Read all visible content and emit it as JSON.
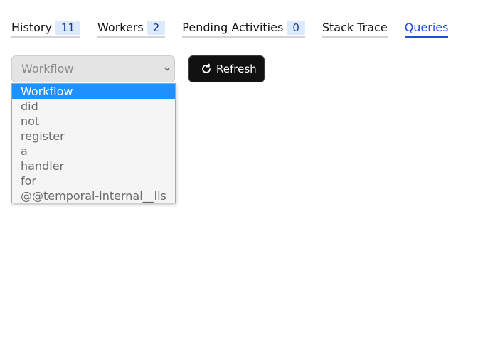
{
  "tabs": [
    {
      "label": "History",
      "badge": "11"
    },
    {
      "label": "Workers",
      "badge": "2"
    },
    {
      "label": "Pending Activities",
      "badge": "0"
    },
    {
      "label": "Stack Trace"
    },
    {
      "label": "Queries",
      "active": true
    }
  ],
  "query_select": {
    "value": "Workflow",
    "icon": "chevron-down-icon",
    "options": [
      "Workflow",
      "did",
      "not",
      "register",
      "a",
      "handler",
      "for",
      "@@temporal-internal__lis"
    ],
    "selected_index": 0
  },
  "refresh_button": {
    "label": "Refresh",
    "icon": "refresh-icon"
  },
  "colors": {
    "accent": "#1d4ed8",
    "badge_bg": "#dbeafe",
    "option_highlight": "#1e90ff",
    "button_bg": "#111111"
  }
}
